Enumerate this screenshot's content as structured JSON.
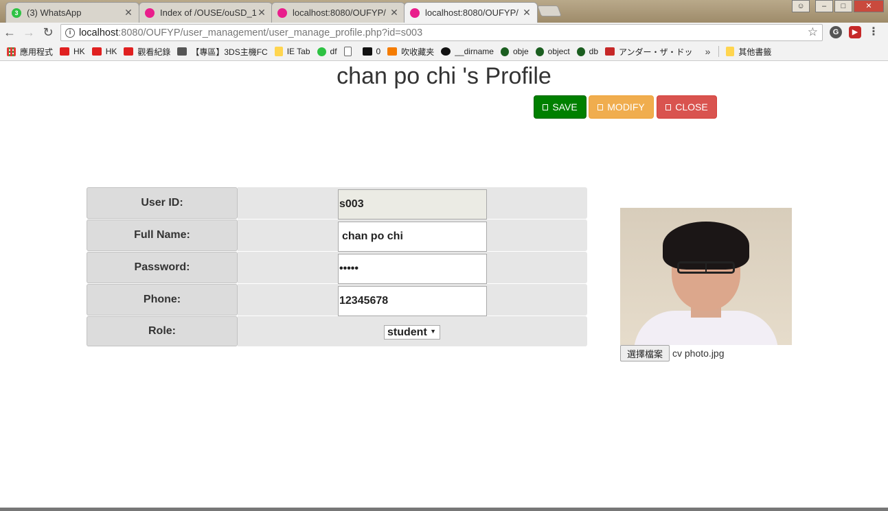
{
  "browser": {
    "tabs": [
      {
        "label": "(3) WhatsApp",
        "badge": "3"
      },
      {
        "label": "Index of /OUSE/ouSD_1"
      },
      {
        "label": "localhost:8080/OUFYP/"
      },
      {
        "label": "localhost:8080/OUFYP/"
      }
    ],
    "close_glyph": "✕",
    "url_host": "localhost",
    "url_path": ":8080/OUFYP/user_management/user_manage_profile.php?id=s003",
    "bookmarks": [
      {
        "label": "應用程式",
        "icon": "apps-icon"
      },
      {
        "label": "HK",
        "icon": "youtube-icon"
      },
      {
        "label": "HK",
        "icon": "youtube-icon"
      },
      {
        "label": "觀看紀錄",
        "icon": "youtube-icon"
      },
      {
        "label": "【專區】3DS主機FC",
        "icon": "dragon-icon"
      },
      {
        "label": "IE Tab",
        "icon": "folder-icon"
      },
      {
        "label": "df",
        "icon": "whatsapp-icon"
      },
      {
        "label": "",
        "icon": "document-icon"
      },
      {
        "label": "0",
        "icon": "black-icon"
      },
      {
        "label": "吹收藏夹",
        "icon": "taobao-icon"
      },
      {
        "label": "__dirname",
        "icon": "github-icon"
      },
      {
        "label": "obje",
        "icon": "mongo-icon"
      },
      {
        "label": "object",
        "icon": "mongo-icon"
      },
      {
        "label": "db",
        "icon": "mongo-icon"
      },
      {
        "label": "アンダー・ザ・ドッ",
        "icon": "red-icon"
      }
    ],
    "bookmarks_more": "»",
    "other_bookmarks": "其他書籤"
  },
  "page": {
    "title": "chan po chi 's Profile",
    "buttons": {
      "save": "SAVE",
      "modify": "MODIFY",
      "close": "CLOSE"
    },
    "form": {
      "user_id_label": "User ID:",
      "user_id_value": "s003",
      "full_name_label": "Full Name:",
      "full_name_value": "chan po chi",
      "password_label": "Password:",
      "password_value": "•••••",
      "phone_label": "Phone:",
      "phone_value": "12345678",
      "role_label": "Role:",
      "role_value": "student"
    },
    "file": {
      "button_label": "選擇檔案",
      "file_name": "cv photo.jpg"
    }
  }
}
